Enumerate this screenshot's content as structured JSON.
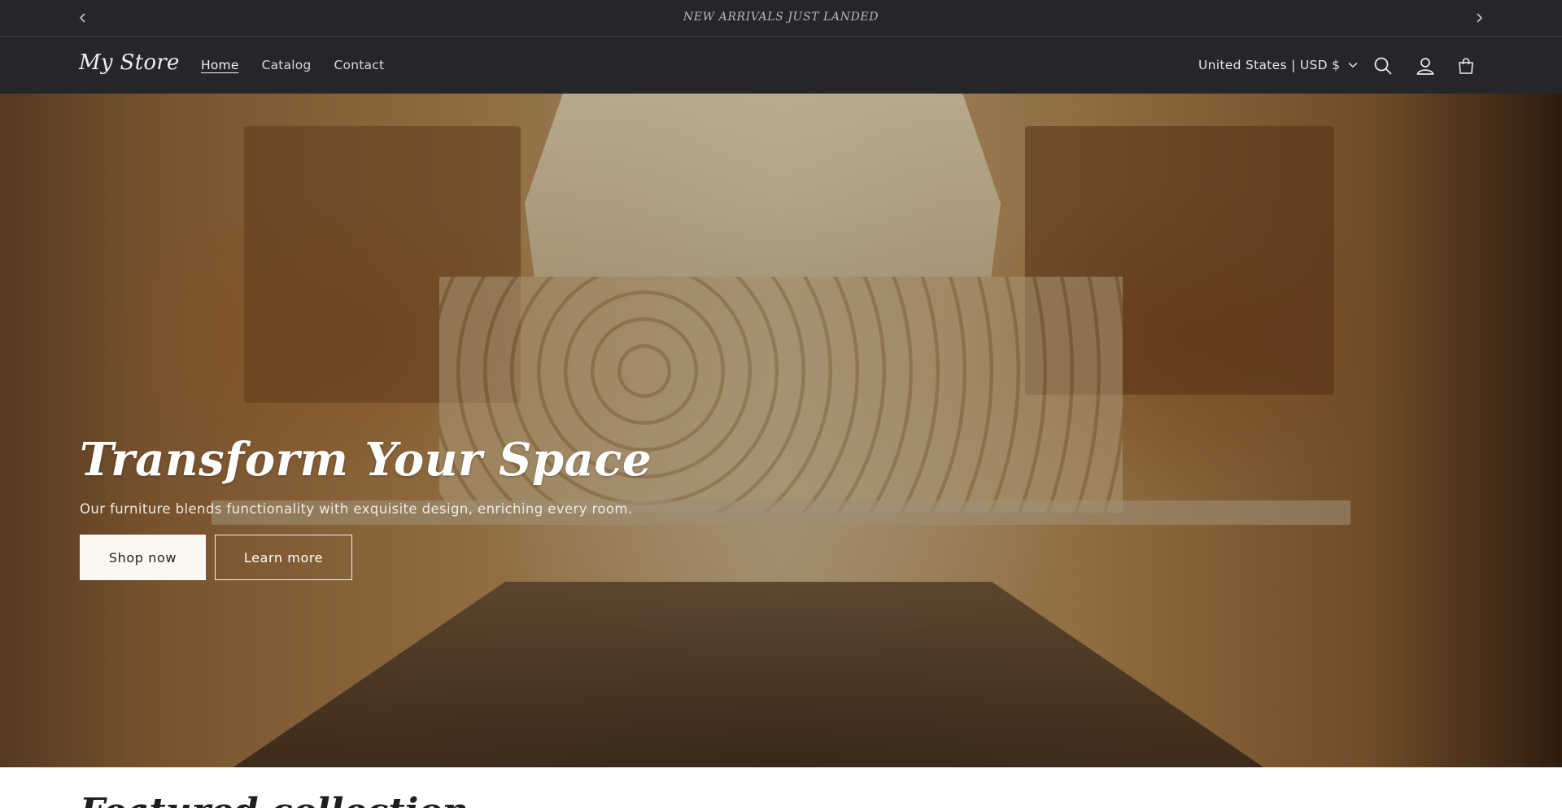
{
  "announcement": {
    "text": "NEW ARRIVALS JUST LANDED",
    "prev_icon": "chevron-left-icon",
    "next_icon": "chevron-right-icon"
  },
  "header": {
    "logo": "My Store",
    "nav": [
      {
        "label": "Home",
        "active": true
      },
      {
        "label": "Catalog",
        "active": false
      },
      {
        "label": "Contact",
        "active": false
      }
    ],
    "country_selector": "United States | USD $",
    "icons": [
      "search-icon",
      "account-icon",
      "cart-icon"
    ]
  },
  "hero": {
    "title": "Transform Your Space",
    "subtitle": "Our furniture blends functionality with exquisite design, enriching every room.",
    "primary_button": "Shop now",
    "secondary_button": "Learn more"
  },
  "next_section": {
    "heading": "Featured collection"
  },
  "colors": {
    "header_bg": "#25262a",
    "button_bg": "#fbf8f1",
    "text_light": "#ffffff"
  }
}
